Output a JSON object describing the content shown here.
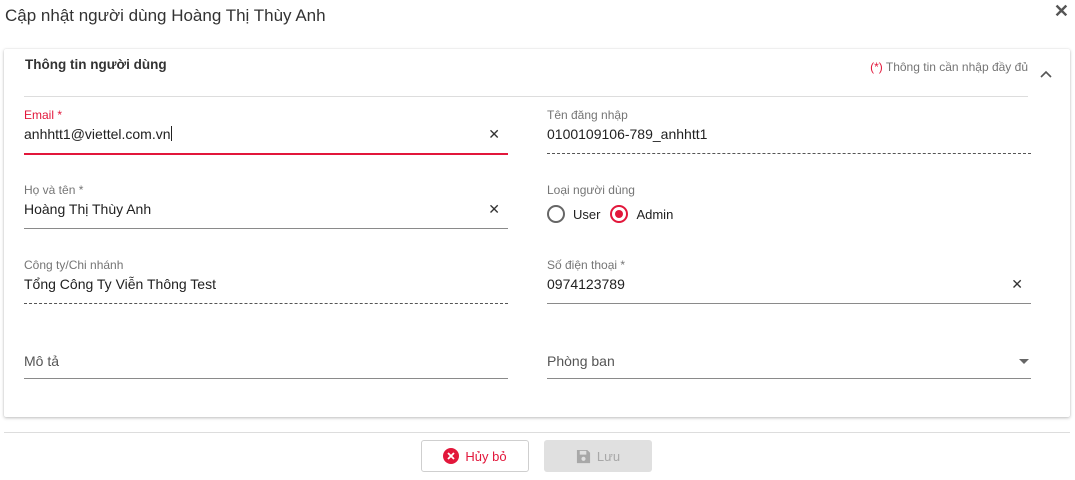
{
  "dialog": {
    "title": "Cập nhật người dùng Hoàng Thị Thùy Anh",
    "close_symbol": "✕"
  },
  "section": {
    "title": "Thông tin người dùng",
    "required_mark": "(*)",
    "required_note": " Thông tin cần nhập đầy đủ"
  },
  "fields": {
    "email": {
      "label": "Email *",
      "value": "anhhtt1@viettel.com.vn"
    },
    "username": {
      "label": "Tên đăng nhập",
      "value": "0100109106-789_anhhtt1"
    },
    "fullname": {
      "label": "Họ và tên *",
      "value": "Hoàng Thị Thùy Anh"
    },
    "user_type": {
      "label": "Loại người dùng",
      "options": [
        "User",
        "Admin"
      ],
      "selected": "Admin"
    },
    "company": {
      "label": "Công ty/Chi nhánh",
      "value": "Tổng Công Ty Viễn Thông Test"
    },
    "phone": {
      "label": "Số điện thoại *",
      "value": "0974123789"
    },
    "description": {
      "placeholder": "Mô tả"
    },
    "department": {
      "placeholder": "Phòng ban"
    }
  },
  "buttons": {
    "cancel": "Hủy bỏ",
    "save": "Lưu"
  },
  "colors": {
    "accent": "#e2173b",
    "disabled_bg": "#e0e0e0"
  },
  "icons": {
    "close": "close-icon",
    "collapse": "chevron-up-icon",
    "clear": "clear-icon",
    "dropdown": "caret-down-icon",
    "cancel": "x-circle-icon",
    "save": "floppy-disk-icon"
  }
}
